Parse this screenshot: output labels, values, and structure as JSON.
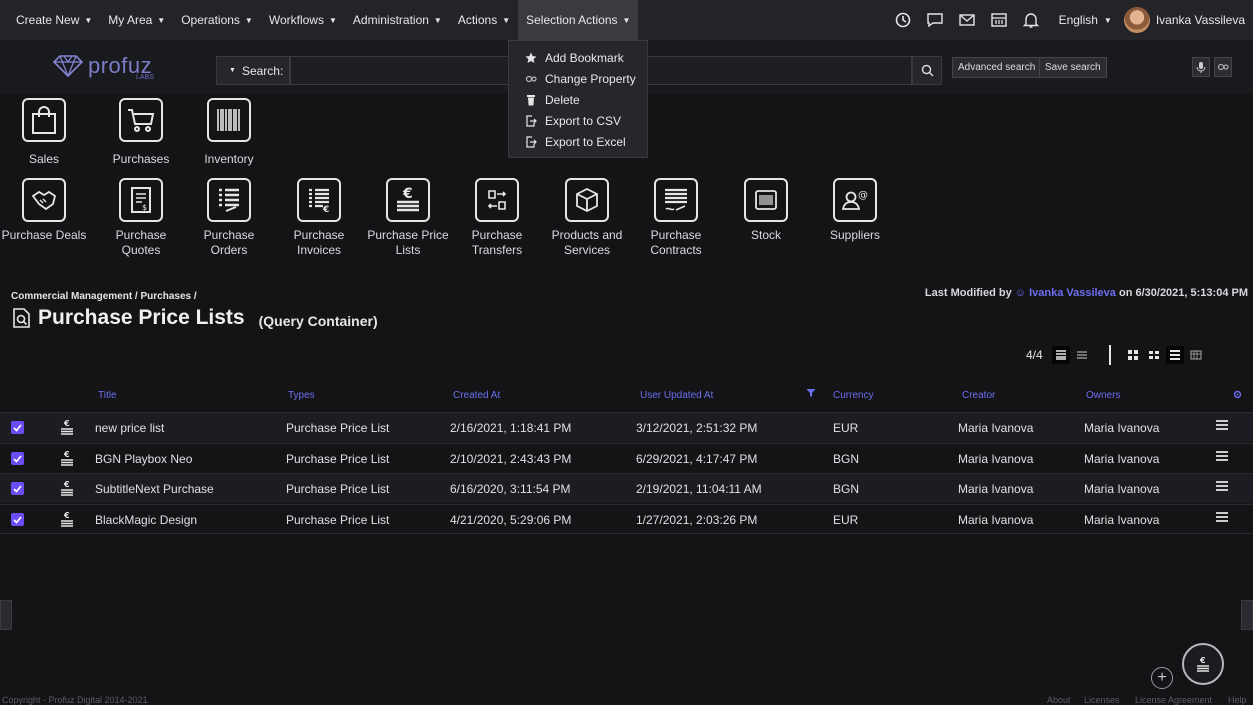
{
  "nav": {
    "items": [
      "Create New",
      "My Area",
      "Operations",
      "Workflows",
      "Administration",
      "Actions",
      "Selection Actions"
    ],
    "language": "English",
    "user": "Ivanka Vassileva"
  },
  "search": {
    "scope_label": "Search:",
    "value": "",
    "advanced_label": "Advanced search",
    "save_label": "Save search"
  },
  "logo": {
    "text": "profuz",
    "sub": "LABS"
  },
  "dropdown": {
    "items": [
      "Add Bookmark",
      "Change Property",
      "Delete",
      "Export to CSV",
      "Export to Excel"
    ]
  },
  "tiles_row1": [
    "Sales",
    "Purchases",
    "Inventory"
  ],
  "tiles_row2": [
    {
      "l1": "Purchase Deals",
      "l2": ""
    },
    {
      "l1": "Purchase",
      "l2": "Quotes"
    },
    {
      "l1": "Purchase",
      "l2": "Orders"
    },
    {
      "l1": "Purchase",
      "l2": "Invoices"
    },
    {
      "l1": "Purchase Price",
      "l2": "Lists"
    },
    {
      "l1": "Purchase",
      "l2": "Transfers"
    },
    {
      "l1": "Products and",
      "l2": "Services"
    },
    {
      "l1": "Purchase",
      "l2": "Contracts"
    },
    {
      "l1": "Stock",
      "l2": ""
    },
    {
      "l1": "Suppliers",
      "l2": ""
    }
  ],
  "breadcrumb": "Commercial Management / Purchases /",
  "last_modified": {
    "prefix": "Last Modified by",
    "user": "Ivanka Vassileva",
    "suffix": "on 6/30/2021, 5:13:04 PM"
  },
  "page": {
    "title": "Purchase Price Lists",
    "subtitle": "(Query Container)"
  },
  "count": "4/4",
  "table": {
    "columns": [
      "Title",
      "Types",
      "Created At",
      "User Updated At",
      "Currency",
      "Creator",
      "Owners"
    ],
    "rows": [
      {
        "title": "new price list",
        "type": "Purchase Price List",
        "created": "2/16/2021, 1:18:41 PM",
        "updated": "3/12/2021, 2:51:32 PM",
        "currency": "EUR",
        "creator": "Maria Ivanova",
        "owners": "Maria Ivanova"
      },
      {
        "title": "BGN Playbox Neo",
        "type": "Purchase Price List",
        "created": "2/10/2021, 2:43:43 PM",
        "updated": "6/29/2021, 4:17:47 PM",
        "currency": "BGN",
        "creator": "Maria Ivanova",
        "owners": "Maria Ivanova"
      },
      {
        "title": "SubtitleNext Purchase",
        "type": "Purchase Price List",
        "created": "6/16/2020, 3:11:54 PM",
        "updated": "2/19/2021, 11:04:11 AM",
        "currency": "BGN",
        "creator": "Maria Ivanova",
        "owners": "Maria Ivanova"
      },
      {
        "title": "BlackMagic Design",
        "type": "Purchase Price List",
        "created": "4/21/2020, 5:29:06 PM",
        "updated": "1/27/2021, 2:03:26 PM",
        "currency": "EUR",
        "creator": "Maria Ivanova",
        "owners": "Maria Ivanova"
      }
    ]
  },
  "footer": {
    "copyright": "Copyright - Profuz Digital 2014-2021",
    "links": [
      "About",
      "Licenses",
      "License Agreement",
      "Help"
    ]
  },
  "colors": {
    "accent": "#6c6ff0",
    "checkbox": "#6c4cf5",
    "background": "#141417"
  }
}
